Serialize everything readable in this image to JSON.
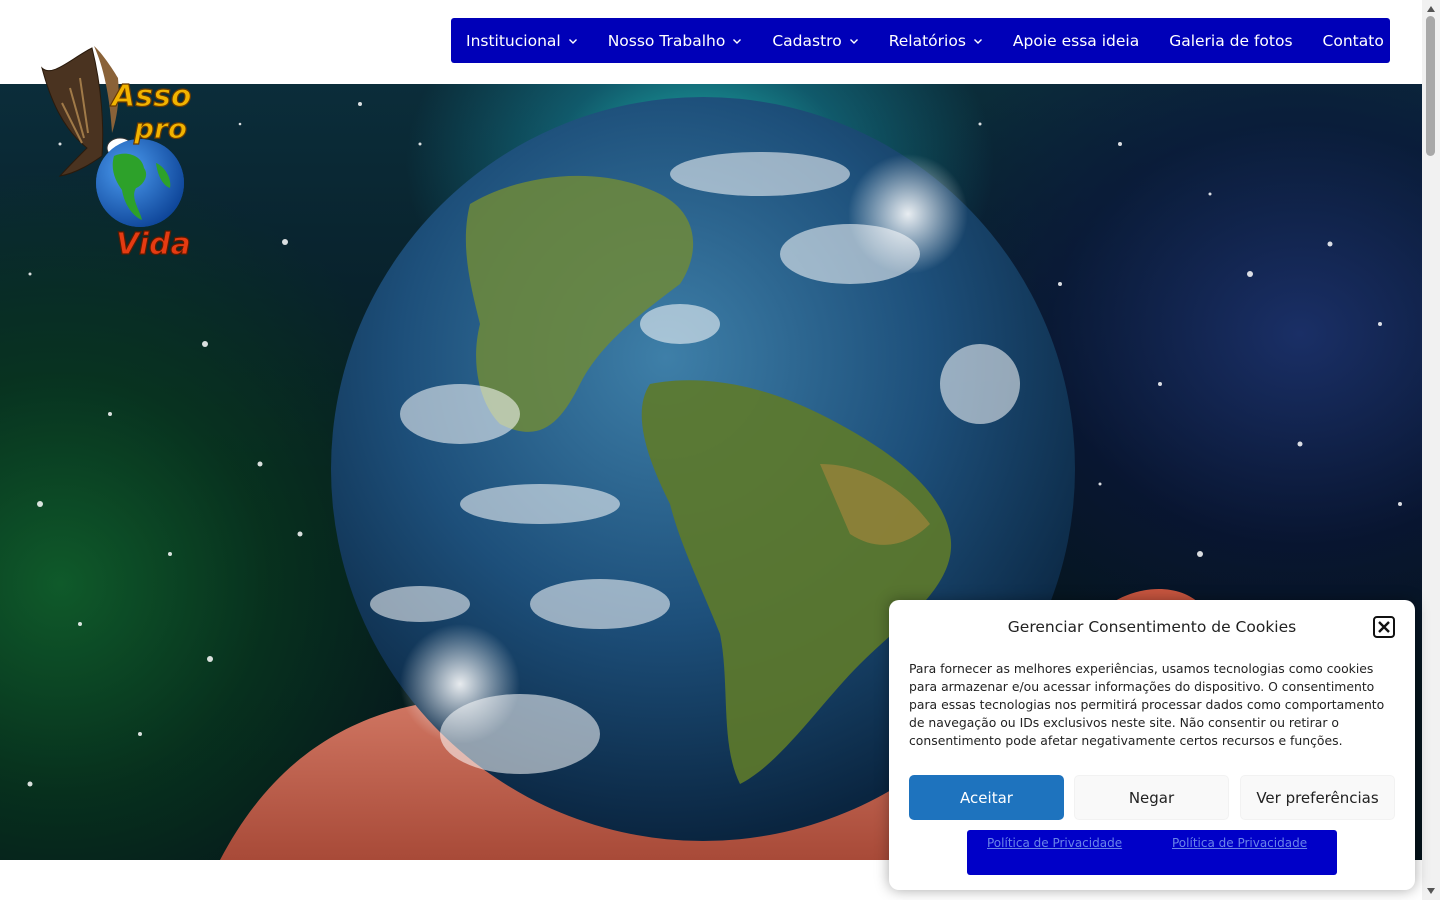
{
  "site": {
    "logo_text": [
      "Asso",
      "pro",
      "Vida"
    ]
  },
  "nav": {
    "items": [
      {
        "label": "Institucional",
        "dropdown": true
      },
      {
        "label": "Nosso Trabalho",
        "dropdown": true
      },
      {
        "label": "Cadastro",
        "dropdown": true
      },
      {
        "label": "Relatórios",
        "dropdown": true
      },
      {
        "label": "Apoie essa ideia",
        "dropdown": false
      },
      {
        "label": "Galeria de fotos",
        "dropdown": false
      },
      {
        "label": "Contato",
        "dropdown": false
      }
    ]
  },
  "cookie": {
    "title": "Gerenciar Consentimento de Cookies",
    "text": "Para fornecer as melhores experiências, usamos tecnologias como cookies para armazenar e/ou acessar informações do dispositivo. O consentimento para essas tecnologias nos permitirá processar dados como comportamento de navegação ou IDs exclusivos neste site. Não consentir ou retirar o consentimento pode afetar negativamente certos recursos e funções.",
    "accept_label": "Aceitar",
    "deny_label": "Negar",
    "prefs_label": "Ver preferências",
    "link1_label": "Política de Privacidade",
    "link2_label": "Política de Privacidade"
  },
  "colors": {
    "nav_bg": "#0000b8",
    "accept_bg": "#1e73be",
    "links_bg": "#0000c8"
  }
}
